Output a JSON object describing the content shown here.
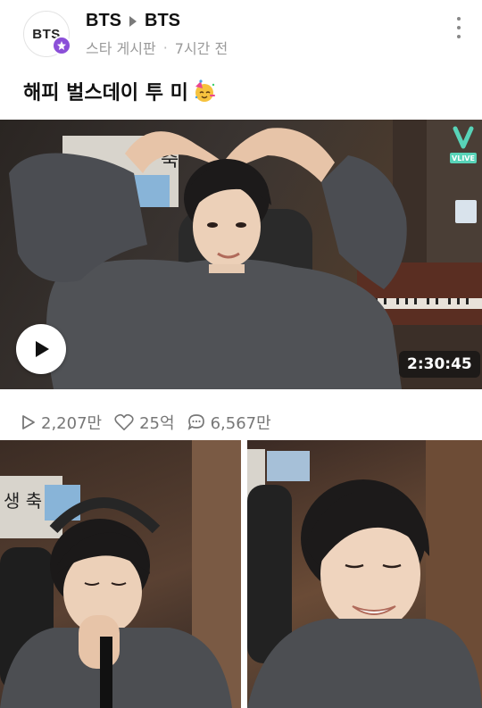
{
  "header": {
    "avatar_text": "BTS",
    "crumb_from": "BTS",
    "crumb_to": "BTS",
    "board": "스타 게시판",
    "time_ago": "7시간 전"
  },
  "post": {
    "title": "해피 벌스데이 투 미",
    "emoji": "partying-face-emoji"
  },
  "video": {
    "duration": "2:30:45",
    "badge": "VLIVE",
    "sign_text": "축"
  },
  "stats": {
    "views": "2,207만",
    "likes": "25억",
    "comments": "6,567만"
  },
  "photos": {
    "left_sign": "생 축"
  },
  "colors": {
    "accent_purple": "#8b4fd8",
    "vlive_green": "#58d3b8",
    "muted_text": "#9a9a9a"
  }
}
